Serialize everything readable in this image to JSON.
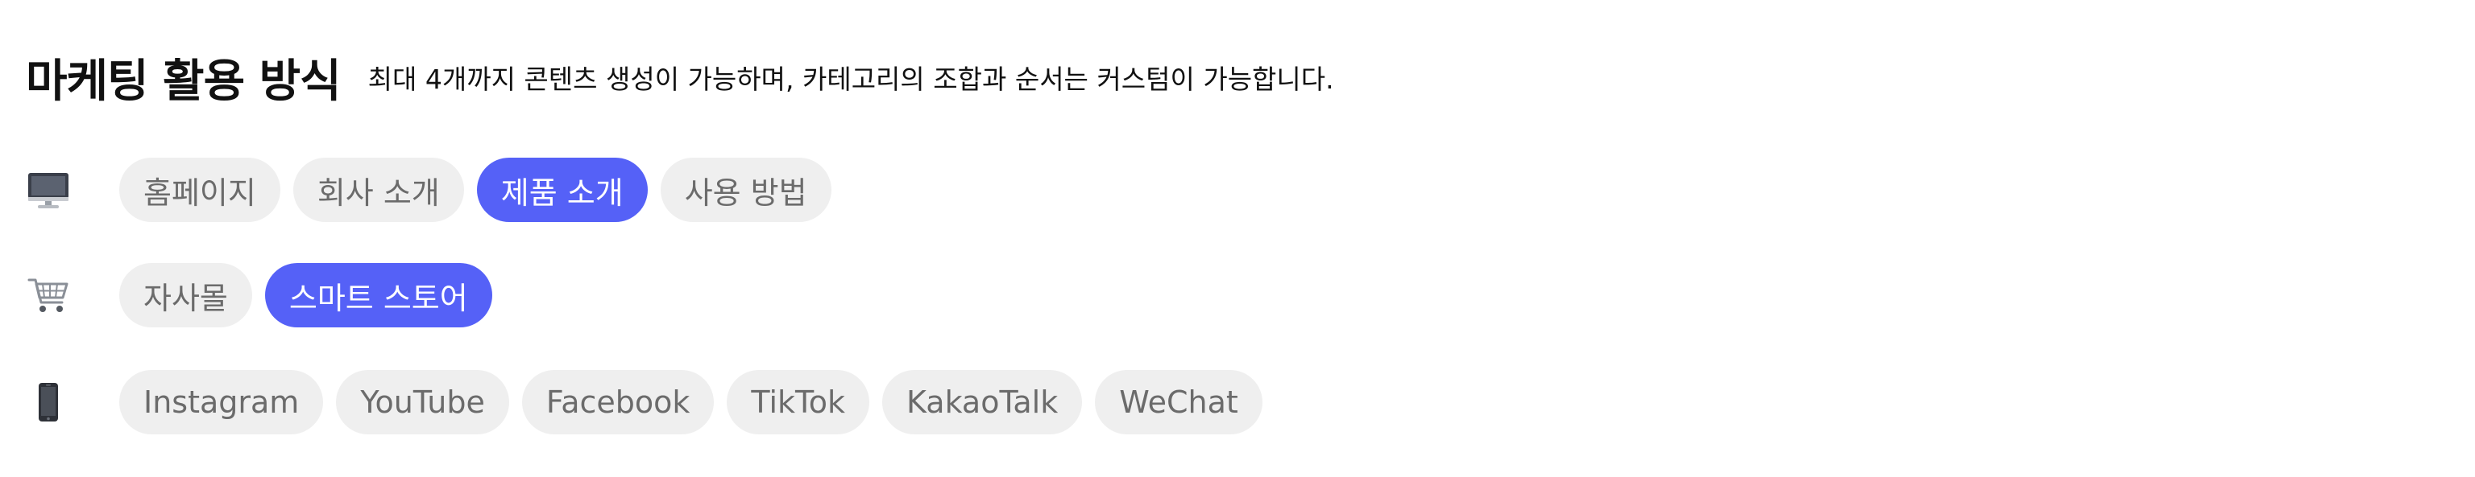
{
  "header": {
    "title": "마케팅 활용 방식",
    "subtitle": "최대 4개까지 콘텐츠 생성이 가능하며,  카테고리의 조합과 순서는 커스텀이 가능합니다."
  },
  "colors": {
    "accent": "#5561f7",
    "chip_bg": "#efefef",
    "chip_text": "#6b6b6b"
  },
  "rows": [
    {
      "icon": "desktop-computer-icon",
      "chips": [
        {
          "label": "홈페이지",
          "selected": false
        },
        {
          "label": "회사 소개",
          "selected": false
        },
        {
          "label": "제품 소개",
          "selected": true
        },
        {
          "label": "사용 방법",
          "selected": false
        }
      ]
    },
    {
      "icon": "shopping-cart-icon",
      "chips": [
        {
          "label": "자사몰",
          "selected": false
        },
        {
          "label": "스마트 스토어",
          "selected": true
        }
      ]
    },
    {
      "icon": "mobile-phone-icon",
      "chips": [
        {
          "label": "Instagram",
          "selected": false
        },
        {
          "label": "YouTube",
          "selected": false
        },
        {
          "label": "Facebook",
          "selected": false
        },
        {
          "label": "TikTok",
          "selected": false
        },
        {
          "label": "KakaoTalk",
          "selected": false
        },
        {
          "label": "WeChat",
          "selected": false
        }
      ]
    }
  ]
}
